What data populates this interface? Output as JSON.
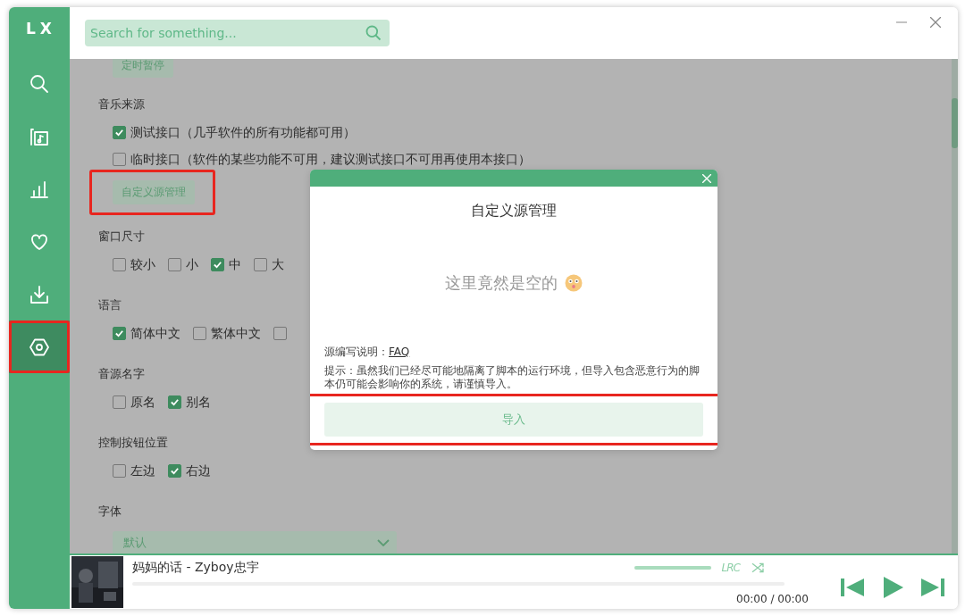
{
  "sidebar": {
    "logo": "LX",
    "items": [
      {
        "kind": "search",
        "selected": false,
        "highlighted": false
      },
      {
        "kind": "playlist",
        "selected": false,
        "highlighted": false
      },
      {
        "kind": "chart",
        "selected": false,
        "highlighted": false
      },
      {
        "kind": "heart",
        "selected": false,
        "highlighted": false
      },
      {
        "kind": "download",
        "selected": false,
        "highlighted": false
      },
      {
        "kind": "settings",
        "selected": true,
        "highlighted": true
      }
    ]
  },
  "search": {
    "placeholder": "Search for something..."
  },
  "settings": {
    "sections": [
      {
        "button": {
          "label": "定时暂停"
        }
      },
      {
        "title": "音乐来源",
        "options": [
          {
            "label": "测试接口（几乎软件的所有功能都可用）",
            "checked": true
          },
          {
            "label": "临时接口（软件的某些功能不可用，建议测试接口不可用再使用本接口）",
            "checked": false
          }
        ],
        "button": {
          "label": "自定义源管理",
          "highlighted": true
        }
      },
      {
        "title": "窗口尺寸",
        "options": [
          {
            "label": "较小",
            "checked": false
          },
          {
            "label": "小",
            "checked": false
          },
          {
            "label": "中",
            "checked": true
          },
          {
            "label": "大",
            "checked": false
          }
        ]
      },
      {
        "title": "语言",
        "options": [
          {
            "label": "简体中文",
            "checked": true
          },
          {
            "label": "繁体中文",
            "checked": false
          },
          {
            "checked": false
          }
        ]
      },
      {
        "title": "音源名字",
        "options": [
          {
            "label": "原名",
            "checked": false
          },
          {
            "label": "别名",
            "checked": true
          }
        ]
      },
      {
        "title": "控制按钮位置",
        "options": [
          {
            "label": "左边",
            "checked": false
          },
          {
            "label": "右边",
            "checked": true
          }
        ]
      },
      {
        "title": "字体",
        "dropdown": {
          "value": "默认"
        }
      }
    ]
  },
  "dialog": {
    "title": "自定义源管理",
    "empty_text": "这里竟然是空的",
    "help_label": "源编写说明：",
    "help_link": "FAQ",
    "notice": "提示：虽然我们已经尽可能地隔离了脚本的运行环境，但导入包含恶意行为的脚本仍可能会影响你的系统，请谨慎导入。",
    "import_button": {
      "label": "导入",
      "highlighted": true
    }
  },
  "player": {
    "title": "妈妈的话 - Zyboy忠宇",
    "time": "00:00 / 00:00",
    "progress": {
      "level": 0
    },
    "volume": {
      "level": 1
    },
    "lyrics_label": "LRC"
  }
}
